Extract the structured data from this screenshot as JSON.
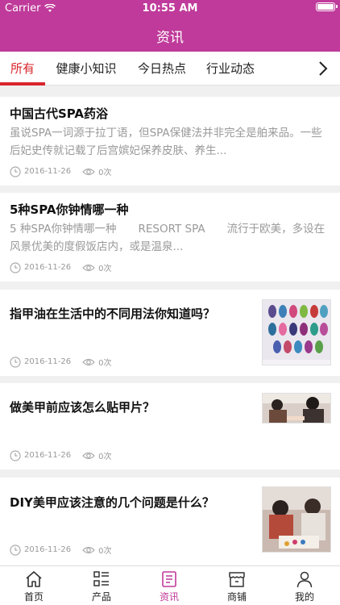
{
  "status": {
    "carrier": "Carrier",
    "time": "10:55 AM"
  },
  "header": {
    "title": "资讯"
  },
  "tabs": [
    {
      "label": "所有",
      "active": true
    },
    {
      "label": "健康小知识"
    },
    {
      "label": "今日热点"
    },
    {
      "label": "行业动态"
    }
  ],
  "articles": [
    {
      "title": "中国古代SPA药浴",
      "summary": "虽说SPA一词源于拉丁语，但SPA保健法并非完全是舶来品。一些后妃史传就记载了后宫嫔妃保养皮肤、养生...",
      "date": "2016-11-26",
      "views": "0次"
    },
    {
      "title": "5种SPA你钟情哪一种",
      "summary": "5 种SPA你钟情哪一种　　RESORT SPA　　流行于欧美，多设在风景优美的度假饭店内，或是温泉...",
      "date": "2016-11-26",
      "views": "0次"
    },
    {
      "title": "指甲油在生活中的不同用法你知道吗？",
      "date": "2016-11-26",
      "views": "0次"
    },
    {
      "title": "做美甲前应该怎么贴甲片？",
      "date": "2016-11-26",
      "views": "0次"
    },
    {
      "title": "DIY美甲应该注意的几个问题是什么？",
      "date": "2016-11-26",
      "views": "0次"
    }
  ],
  "bottom_nav": [
    {
      "label": "首页",
      "icon": "home-icon"
    },
    {
      "label": "产品",
      "icon": "list-icon"
    },
    {
      "label": "资讯",
      "icon": "news-icon",
      "active": true
    },
    {
      "label": "商铺",
      "icon": "shop-icon"
    },
    {
      "label": "我的",
      "icon": "user-icon"
    }
  ],
  "colors": {
    "brand": "#bf3a9a",
    "tab_active": "#d8262c",
    "muted": "#999999"
  }
}
